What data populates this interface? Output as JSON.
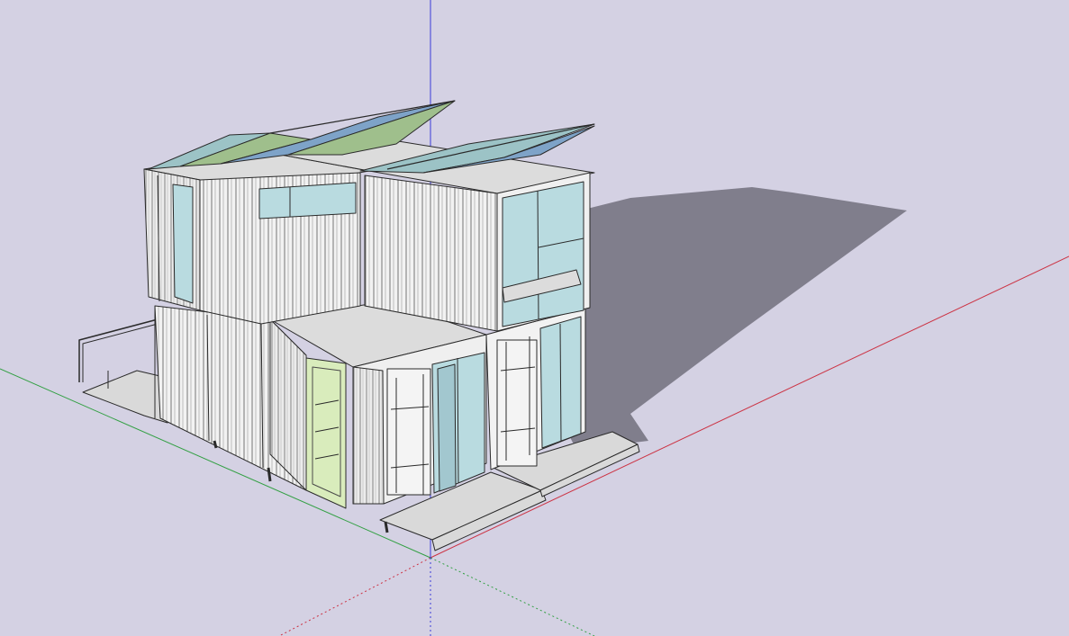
{
  "viewport": {
    "background": "#d4d1e3",
    "axis_colors": {
      "red_axis": "#cc3344",
      "green_axis": "#33a044",
      "blue_axis": "#3a3ad8"
    },
    "shadow_color": "#807e8c",
    "model_colors": {
      "container_fill": "#f1f1f1",
      "container_side": "#e6e6e6",
      "container_roof": "#dcdcdc",
      "outline": "#2a2a2a",
      "glass": "#b9dbe0",
      "glass_dark": "#a2c7cf",
      "green_door": "#d9ecbc",
      "solar_panel_a": "#9cc3c6",
      "solar_panel_b": "#9fbf8c",
      "solar_panel_c": "#7ea3c8",
      "deck": "#d9d9d9"
    }
  }
}
